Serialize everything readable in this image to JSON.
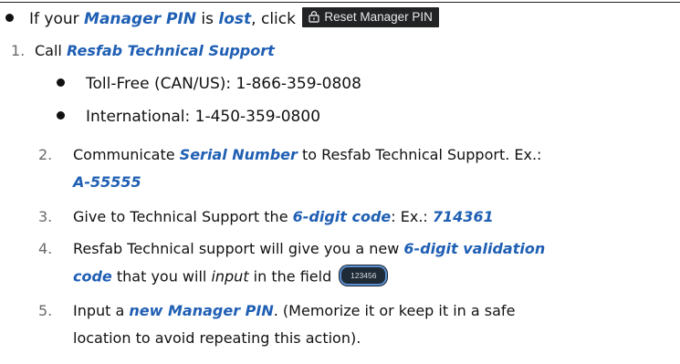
{
  "intro": {
    "p1": "If your ",
    "manager_pin": "Manager PIN",
    "p2": " is ",
    "lost": "lost",
    "p3": ", click ",
    "reset_button_label": "Reset Manager PIN"
  },
  "step1": {
    "number": "1.",
    "p1": "Call ",
    "support": "Resfab Technical Support",
    "phones": [
      "Toll-Free (CAN/US): 1-866-359-0808",
      "International: 1-450-359-0800"
    ]
  },
  "step2": {
    "number": "2.",
    "p1": "Communicate ",
    "serial": "Serial Number",
    "p2": " to Resfab Technical Support. Ex.:",
    "example": "A-55555"
  },
  "step3": {
    "number": "3.",
    "p1": "Give to Technical Support the ",
    "code": "6-digit code",
    "p2": ": Ex.: ",
    "example": "714361"
  },
  "step4": {
    "number": "4.",
    "p1": "Resfab Technical support will give you a new ",
    "validation_a": "6-digit validation",
    "validation_b": "code",
    "p2": " that you will ",
    "input_word": "input",
    "p3": " in the field ",
    "field_value": "123456"
  },
  "step5": {
    "number": "5.",
    "p1": "Input a ",
    "new_pin": "new Manager PIN",
    "p2": ". (Memorize it or keep it in a safe",
    "line2": "location to avoid repeating this action)."
  },
  "colors": {
    "emphasis": "#1f5fb4",
    "number": "#6a6a6a",
    "button_bg": "#222325",
    "field_border": "#5a8fd0"
  }
}
